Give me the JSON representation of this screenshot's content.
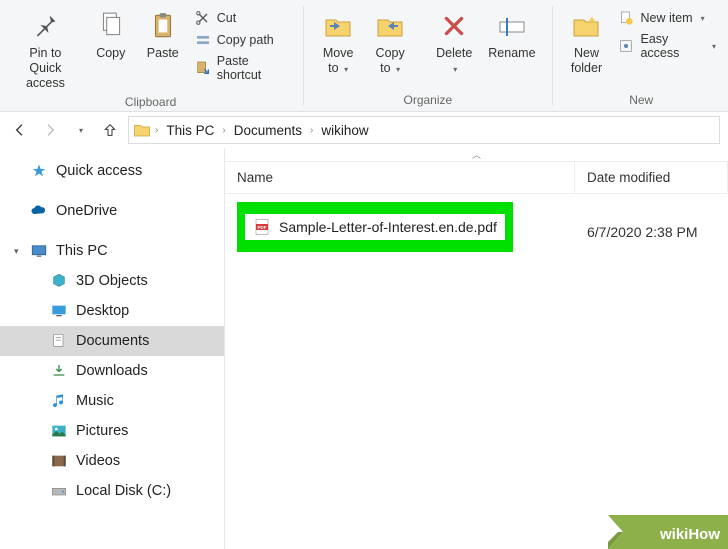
{
  "ribbon": {
    "clipboard": {
      "label": "Clipboard",
      "pin": "Pin to Quick\naccess",
      "copy": "Copy",
      "paste": "Paste",
      "cut": "Cut",
      "copy_path": "Copy path",
      "paste_shortcut": "Paste shortcut"
    },
    "organize": {
      "label": "Organize",
      "move_to": "Move\nto",
      "copy_to": "Copy\nto",
      "delete": "Delete",
      "rename": "Rename"
    },
    "new": {
      "label": "New",
      "new_folder": "New\nfolder",
      "new_item": "New item",
      "easy_access": "Easy access"
    }
  },
  "breadcrumb": {
    "items": [
      "This PC",
      "Documents",
      "wikihow"
    ]
  },
  "sidebar": {
    "quick_access": "Quick access",
    "onedrive": "OneDrive",
    "this_pc": "This PC",
    "children": {
      "objects3d": "3D Objects",
      "desktop": "Desktop",
      "documents": "Documents",
      "downloads": "Downloads",
      "music": "Music",
      "pictures": "Pictures",
      "videos": "Videos",
      "local_disk": "Local Disk (C:)"
    }
  },
  "columns": {
    "name": "Name",
    "date": "Date modified"
  },
  "file": {
    "name": "Sample-Letter-of-Interest.en.de.pdf",
    "date": "6/7/2020 2:38 PM"
  },
  "watermark": "wikiHow"
}
